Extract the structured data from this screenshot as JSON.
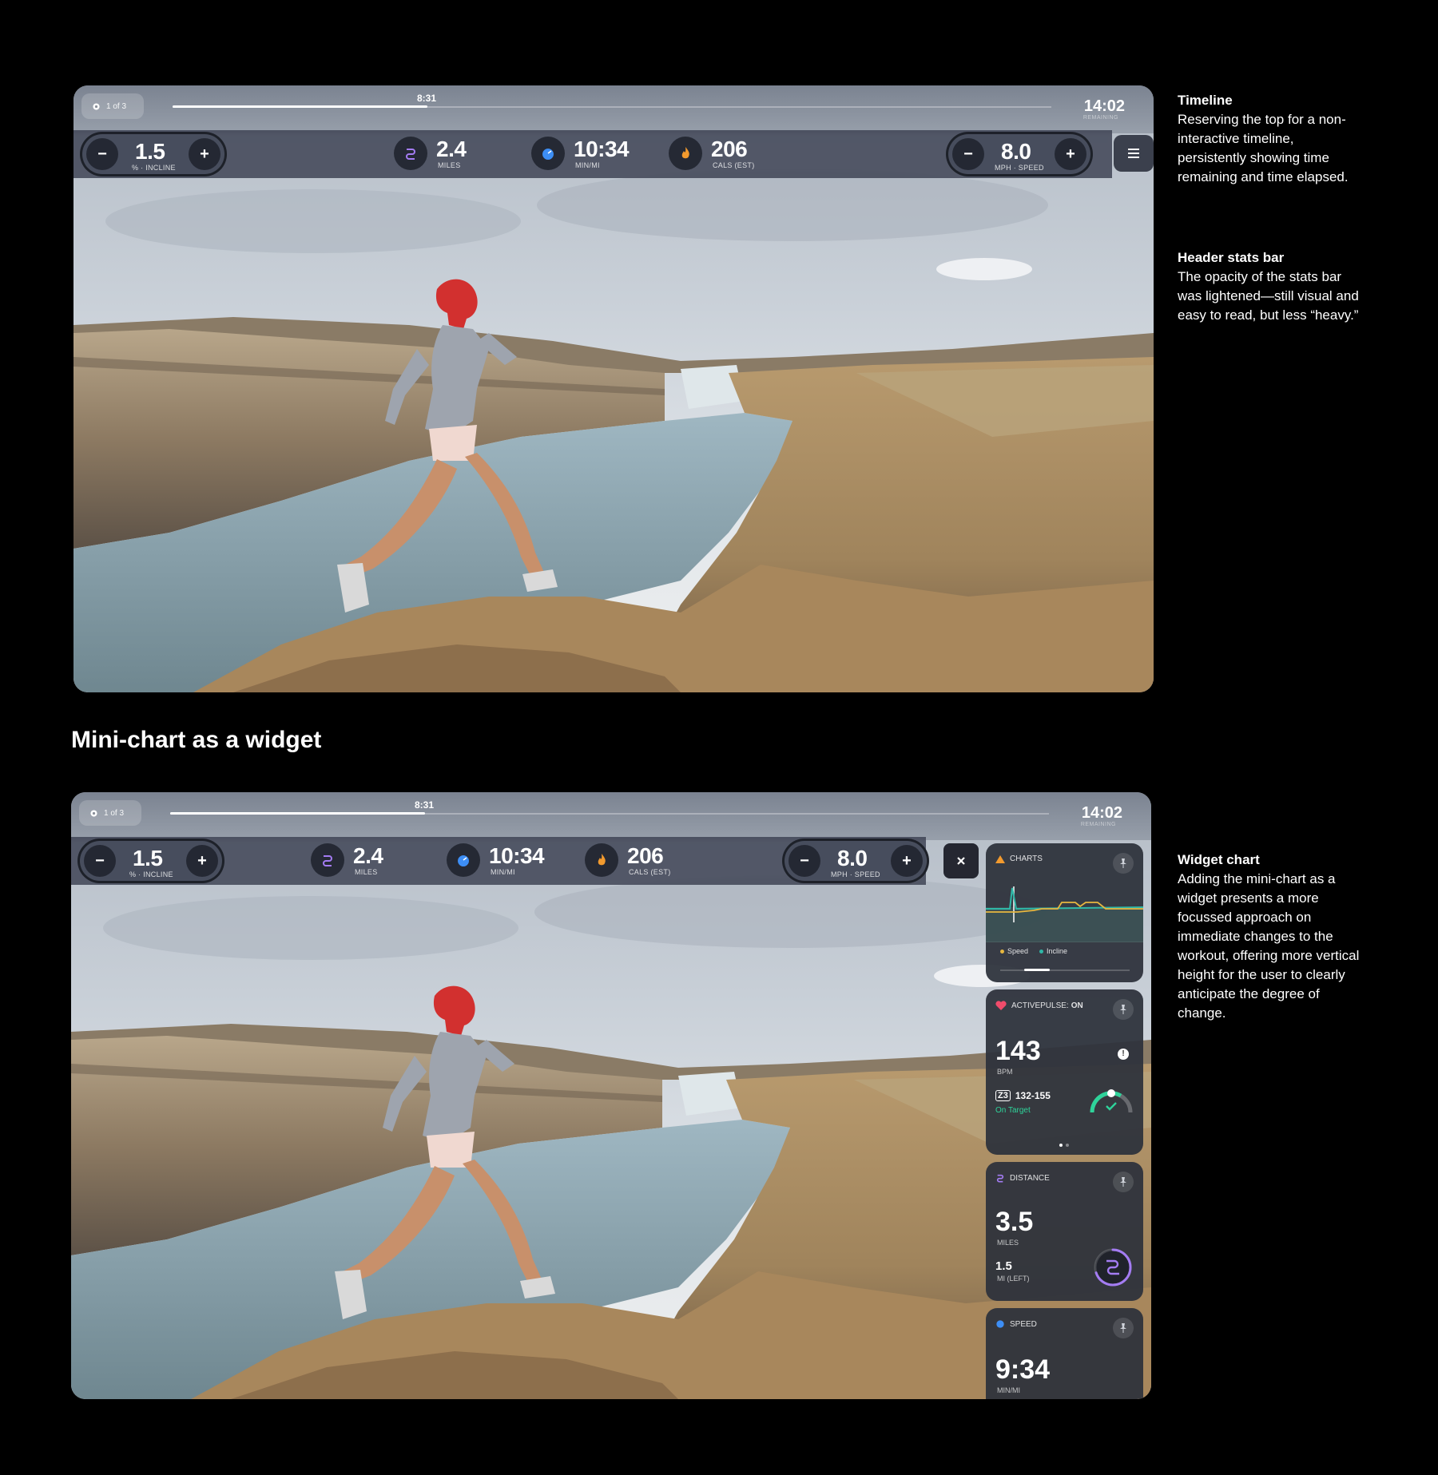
{
  "section_heading": "Mini-chart as a widget",
  "notes": [
    {
      "title": "Timeline",
      "body": "Reserving the top for a non-interactive timeline, persistently showing time remaining and time elapsed."
    },
    {
      "title": "Header stats bar",
      "body": "The opacity of the stats bar was lightened—still visual and easy to read, but less “heavy.”"
    },
    {
      "title": "Widget chart",
      "body": "Adding the mini-chart as a widget presents a more focussed approach on immediate changes to the workout, offering more vertical height for the user to clearly anticipate the degree of change."
    }
  ],
  "workout": {
    "segment": "1 of 3",
    "elapsed": "8:31",
    "remaining": "14:02",
    "remaining_label": "REMAINING",
    "progress": 0.29
  },
  "stats": {
    "incline": {
      "value": "1.5",
      "label": "% · INCLINE"
    },
    "miles": {
      "value": "2.4",
      "label": "MILES"
    },
    "pace": {
      "value": "10:34",
      "label": "MIN/MI"
    },
    "calories": {
      "value": "206",
      "label": "CALS (EST)"
    },
    "speed": {
      "value": "8.0",
      "label": "MPH · SPEED"
    },
    "minus": "−",
    "plus": "+"
  },
  "widgets": {
    "charts": {
      "title": "CHARTS",
      "legend_speed": "Speed",
      "legend_incline": "Incline"
    },
    "activepulse": {
      "title": "ACTIVEPULSE:",
      "state": "ON",
      "bpm": "143",
      "bpm_label": "BPM",
      "zone": "Z3",
      "zone_range": "132-155",
      "status": "On Target"
    },
    "distance": {
      "title": "DISTANCE",
      "value": "3.5",
      "unit": "MILES",
      "left": "1.5",
      "left_label": "MI (LEFT)",
      "progress": 0.7
    },
    "speed": {
      "title": "SPEED",
      "value": "9:34",
      "unit": "MIN/MI"
    }
  },
  "colors": {
    "accent_purple": "#a47cf3",
    "accent_blue": "#3d8ef5",
    "accent_orange": "#f29a2e",
    "heart_red": "#f04c6b",
    "zone_green": "#2ed39a",
    "speed_line": "#e7b73f",
    "incline_line": "#2fb7a7"
  },
  "icons": [
    "gear-icon",
    "distance-icon",
    "pace-icon",
    "flame-icon",
    "menu-icon",
    "close-icon",
    "chart-icon",
    "pin-icon",
    "heart-icon",
    "info-icon",
    "check-icon"
  ]
}
